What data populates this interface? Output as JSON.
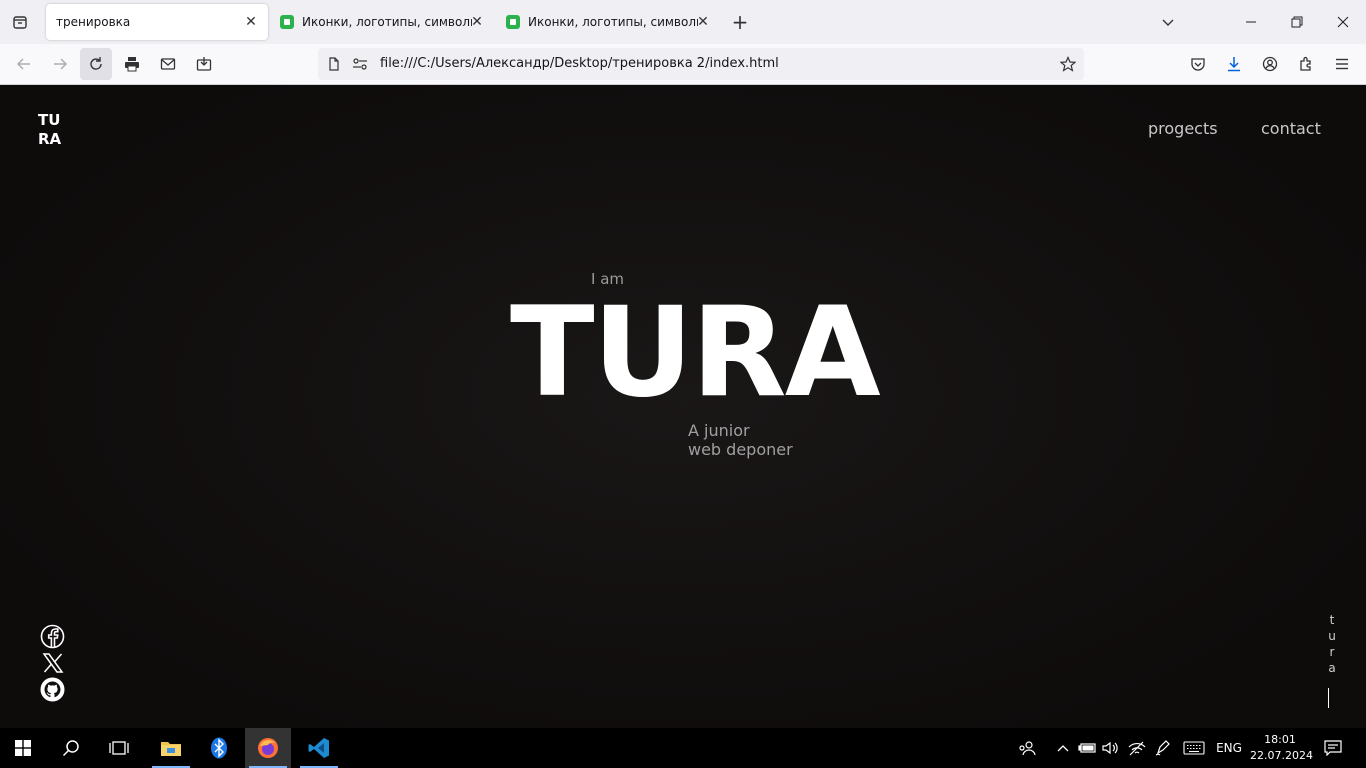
{
  "browser": {
    "tabs": [
      {
        "title": "тренировка",
        "active": true
      },
      {
        "title": "Иконки, логотипы, символы |",
        "active": false
      },
      {
        "title": "Иконки, логотипы, символы |",
        "active": false
      }
    ],
    "url": "file:///C:/Users/Александр/Desktop/тренировка 2/index.html"
  },
  "page": {
    "logo_line1": "TU",
    "logo_line2": "RA",
    "nav": {
      "projects": "progects",
      "contact": "contact"
    },
    "hero": {
      "pre": "I am",
      "title": "TURA",
      "sub_line1": "A junior",
      "sub_line2": "web deponer"
    },
    "vertical_letters": [
      "t",
      "u",
      "r",
      "a"
    ],
    "social_icons": [
      "facebook-icon",
      "x-icon",
      "github-icon"
    ]
  },
  "taskbar": {
    "language": "ENG",
    "time": "18:01",
    "date": "22.07.2024"
  }
}
